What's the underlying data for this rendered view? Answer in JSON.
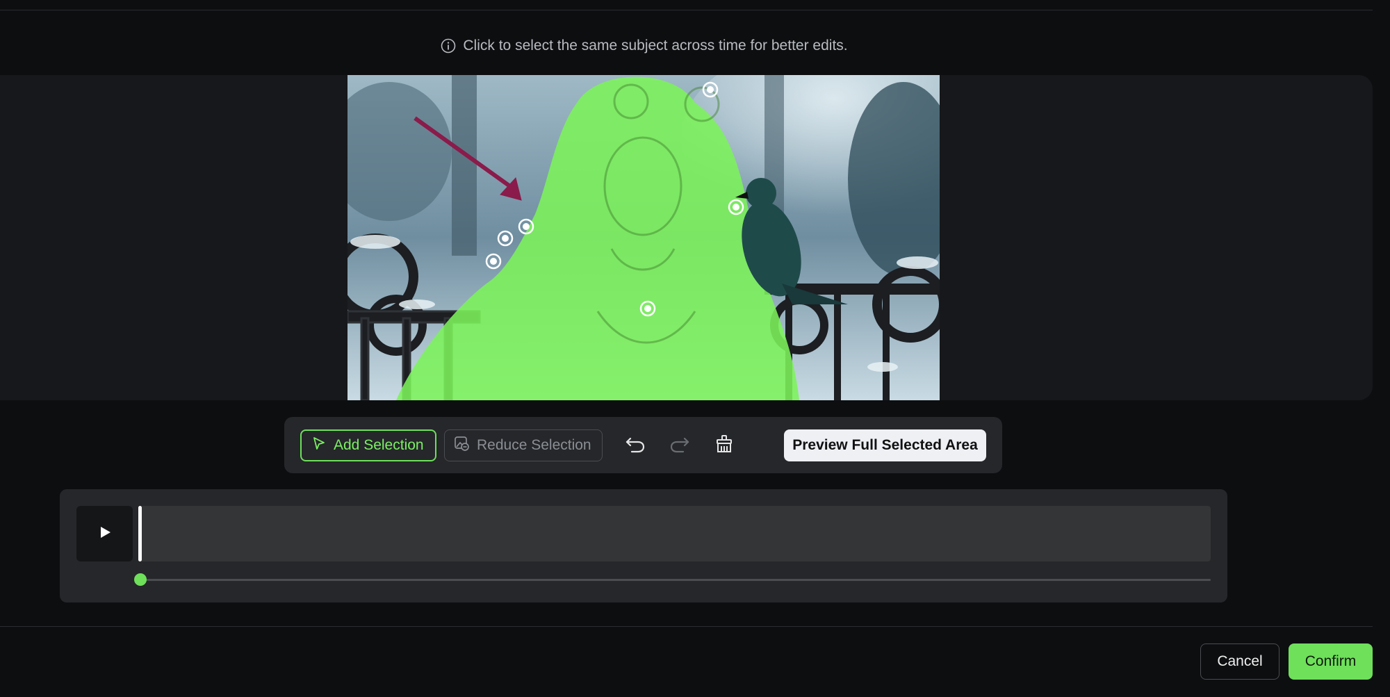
{
  "hint": {
    "text": "Click to select the same subject across time for better edits.",
    "icon": "info-icon"
  },
  "toolbar": {
    "add_selection_label": "Add Selection",
    "add_selection_icon": "cursor-arrow-icon",
    "reduce_selection_label": "Reduce Selection",
    "reduce_selection_icon": "image-minus-icon",
    "undo_icon": "undo-icon",
    "redo_icon": "redo-icon",
    "clear_icon": "brush-clear-icon",
    "preview_label": "Preview Full Selected Area"
  },
  "timeline": {
    "play_icon": "play-icon",
    "position": 0
  },
  "footer": {
    "cancel_label": "Cancel",
    "confirm_label": "Confirm"
  },
  "colors": {
    "accent": "#6ee05a",
    "selection_overlay": "#7cf25a",
    "annotation_arrow": "#8a1b4a",
    "background": "#0d0e10"
  }
}
